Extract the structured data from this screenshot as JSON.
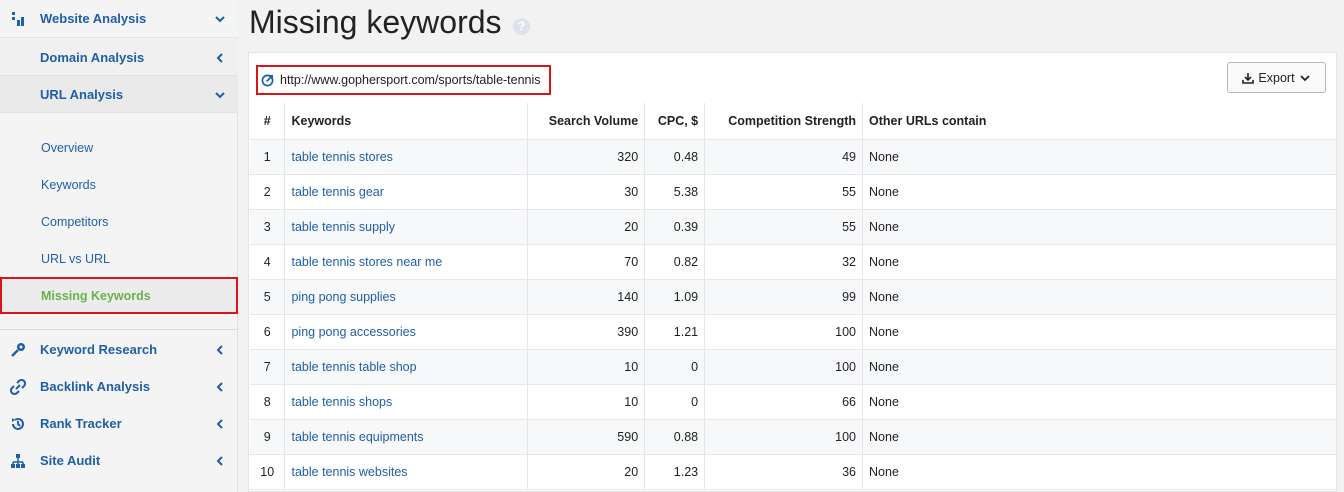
{
  "sidebar": {
    "website_analysis": "Website Analysis",
    "domain_analysis": "Domain Analysis",
    "url_analysis": "URL Analysis",
    "items": [
      "Overview",
      "Keywords",
      "Competitors",
      "URL vs URL",
      "Missing Keywords"
    ],
    "keyword_research": "Keyword Research",
    "backlink_analysis": "Backlink Analysis",
    "rank_tracker": "Rank Tracker",
    "site_audit": "Site Audit"
  },
  "page": {
    "title": "Missing keywords",
    "help": "?"
  },
  "panel": {
    "url": "http://www.gophersport.com/sports/table-tennis",
    "export_label": "Export"
  },
  "table": {
    "headers": [
      "#",
      "Keywords",
      "Search Volume",
      "CPC, $",
      "Competition Strength",
      "Other URLs contain"
    ],
    "rows": [
      [
        "1",
        "table tennis stores",
        "320",
        "0.48",
        "49",
        "None"
      ],
      [
        "2",
        "table tennis gear",
        "30",
        "5.38",
        "55",
        "None"
      ],
      [
        "3",
        "table tennis supply",
        "20",
        "0.39",
        "55",
        "None"
      ],
      [
        "4",
        "table tennis stores near me",
        "70",
        "0.82",
        "32",
        "None"
      ],
      [
        "5",
        "ping pong supplies",
        "140",
        "1.09",
        "99",
        "None"
      ],
      [
        "6",
        "ping pong accessories",
        "390",
        "1.21",
        "100",
        "None"
      ],
      [
        "7",
        "table tennis table shop",
        "10",
        "0",
        "100",
        "None"
      ],
      [
        "8",
        "table tennis shops",
        "10",
        "0",
        "66",
        "None"
      ],
      [
        "9",
        "table tennis equipments",
        "590",
        "0.88",
        "100",
        "None"
      ],
      [
        "10",
        "table tennis websites",
        "20",
        "1.23",
        "36",
        "None"
      ]
    ]
  },
  "colors": {
    "accent": "#1f5fa8",
    "active": "#6ab04c",
    "highlight": "#d9141b"
  }
}
